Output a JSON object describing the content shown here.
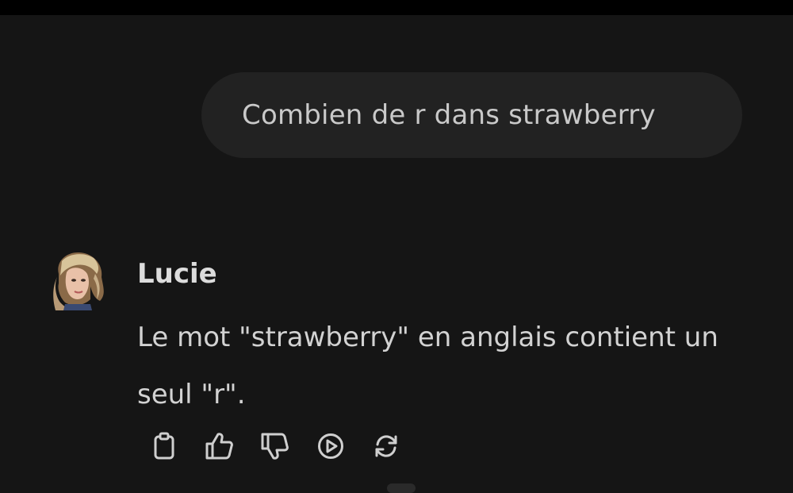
{
  "conversation": {
    "user_message": "Combien de r dans strawberry",
    "assistant": {
      "name": "Lucie",
      "message": "Le mot \"strawberry\" en anglais contient un seul \"r\"."
    }
  },
  "actions": [
    {
      "icon": "clipboard-icon"
    },
    {
      "icon": "thumbs-up-icon"
    },
    {
      "icon": "thumbs-down-icon"
    },
    {
      "icon": "play-circle-icon"
    },
    {
      "icon": "refresh-icon"
    }
  ],
  "colors": {
    "background": "#151515",
    "top_bar": "#000000",
    "user_bubble": "#222222",
    "text": "#d2d2d2",
    "icon": "#cfcfcf"
  }
}
